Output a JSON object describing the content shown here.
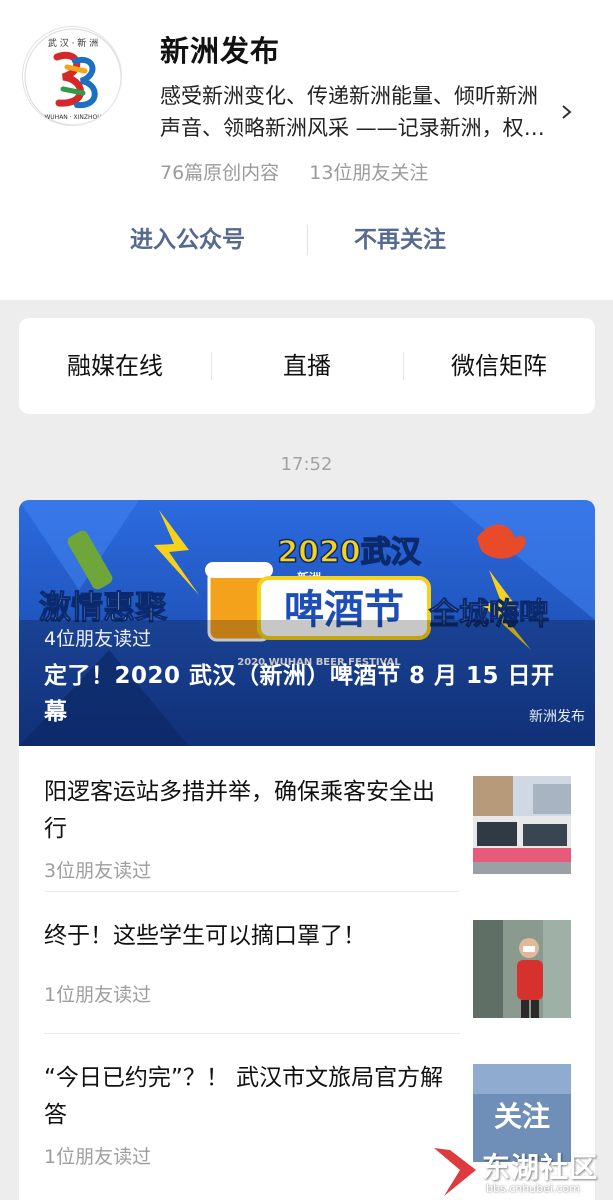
{
  "account": {
    "name": "新洲发布",
    "description": "感受新洲变化、传递新洲能量、倾听新洲声音、领略新洲风采 ——记录新洲，权威发布",
    "avatar_text_top": "武 汉 · 新 洲",
    "avatar_text_bottom": "WUHAN · XINZHOU",
    "original_count": "76篇原创内容",
    "friends_following": "13位朋友关注"
  },
  "actions": {
    "enter_label": "进入公众号",
    "unfollow_label": "不再关注"
  },
  "menu": {
    "items": [
      {
        "label": "融媒在线"
      },
      {
        "label": "直播"
      },
      {
        "label": "微信矩阵"
      }
    ]
  },
  "timestamp": "17:52",
  "featured": {
    "read_by": "4位朋友读过",
    "title": "定了！2020 武汉（新洲）啤酒节 8 月 15 日开幕",
    "banner_year": "2020武汉",
    "banner_main": "啤酒节",
    "banner_left": "激情惠聚",
    "banner_right": "全城嗨啤",
    "banner_en": "2020 WUHAN BEER FESTIVAL",
    "banner_tag": "新洲",
    "watermark": "新洲发布"
  },
  "articles": [
    {
      "title": "阳逻客运站多措并举，确保乘客安全出行",
      "read_by": "3位朋友读过"
    },
    {
      "title": "终于！这些学生可以摘口罩了！",
      "read_by": "1位朋友读过"
    },
    {
      "title": "“今日已约完”？！ 武汉市文旅局官方解答",
      "read_by": "1位朋友读过",
      "thumb_text": "关注"
    }
  ],
  "site_watermark": {
    "text": "东湖社区",
    "url": "bbs.cnhubei.com"
  },
  "colors": {
    "link_blue": "#566a8f",
    "banner_blue": "#1e4fb8",
    "banner_yellow": "#f7d21a"
  }
}
